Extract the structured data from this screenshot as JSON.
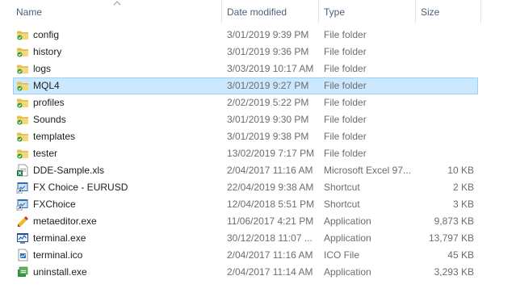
{
  "columns": {
    "name": "Name",
    "date": "Date modified",
    "type": "Type",
    "size": "Size"
  },
  "colors": {
    "header_text": "#4c607a",
    "selection_fill": "#cce8ff",
    "selection_border": "#99d1ff",
    "folder": "#e8c25a"
  },
  "files": [
    {
      "name": "config",
      "date": "3/01/2019 9:39 PM",
      "type": "File folder",
      "size": "",
      "icon": "folder-icon",
      "selected": false
    },
    {
      "name": "history",
      "date": "3/01/2019 9:36 PM",
      "type": "File folder",
      "size": "",
      "icon": "folder-icon",
      "selected": false
    },
    {
      "name": "logs",
      "date": "3/03/2019 10:17 AM",
      "type": "File folder",
      "size": "",
      "icon": "folder-icon",
      "selected": false
    },
    {
      "name": "MQL4",
      "date": "3/01/2019 9:27 PM",
      "type": "File folder",
      "size": "",
      "icon": "folder-icon",
      "selected": true
    },
    {
      "name": "profiles",
      "date": "2/02/2019 5:22 PM",
      "type": "File folder",
      "size": "",
      "icon": "folder-icon",
      "selected": false
    },
    {
      "name": "Sounds",
      "date": "3/01/2019 9:30 PM",
      "type": "File folder",
      "size": "",
      "icon": "folder-icon",
      "selected": false
    },
    {
      "name": "templates",
      "date": "3/01/2019 9:38 PM",
      "type": "File folder",
      "size": "",
      "icon": "folder-icon",
      "selected": false
    },
    {
      "name": "tester",
      "date": "13/02/2019 7:17 PM",
      "type": "File folder",
      "size": "",
      "icon": "folder-icon",
      "selected": false
    },
    {
      "name": "DDE-Sample.xls",
      "date": "2/04/2017 11:16 AM",
      "type": "Microsoft Excel 97...",
      "size": "10 KB",
      "icon": "excel-file-icon",
      "selected": false
    },
    {
      "name": "FX Choice - EURUSD",
      "date": "22/04/2019 9:38 AM",
      "type": "Shortcut",
      "size": "2 KB",
      "icon": "shortcut-icon",
      "selected": false
    },
    {
      "name": "FXChoice",
      "date": "12/04/2018 5:51 PM",
      "type": "Shortcut",
      "size": "3 KB",
      "icon": "shortcut-icon",
      "selected": false
    },
    {
      "name": "metaeditor.exe",
      "date": "11/06/2017 4:21 PM",
      "type": "Application",
      "size": "9,873 KB",
      "icon": "editor-app-icon",
      "selected": false
    },
    {
      "name": "terminal.exe",
      "date": "30/12/2018 11:07 ...",
      "type": "Application",
      "size": "13,797 KB",
      "icon": "terminal-app-icon",
      "selected": false
    },
    {
      "name": "terminal.ico",
      "date": "2/04/2017 11:16 AM",
      "type": "ICO File",
      "size": "45 KB",
      "icon": "ico-file-icon",
      "selected": false
    },
    {
      "name": "uninstall.exe",
      "date": "2/04/2017 11:14 AM",
      "type": "Application",
      "size": "3,293 KB",
      "icon": "uninstall-app-icon",
      "selected": false
    }
  ]
}
